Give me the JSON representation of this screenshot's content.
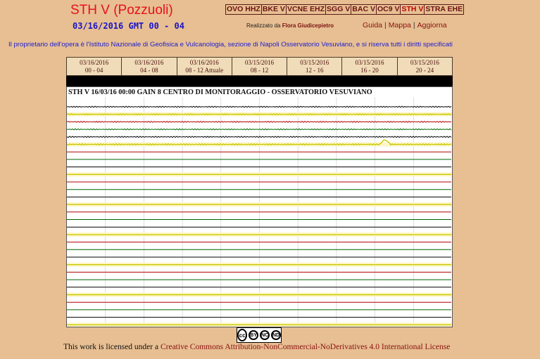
{
  "header": {
    "title": "STH V (Pozzuoli)",
    "subtitle": "03/16/2016 GMT 00 - 04",
    "credit_prefix": "Realizzato da",
    "credit_author": "Flora Giudicepietro"
  },
  "stations": [
    {
      "label": "OVO HHZ"
    },
    {
      "label": "BKE V"
    },
    {
      "label": "VCNE EHZ"
    },
    {
      "label": "SGG V"
    },
    {
      "label": "BAC V"
    },
    {
      "label": "OC9 V"
    },
    {
      "label": "STH V"
    },
    {
      "label": "STRA EHE"
    }
  ],
  "nav": {
    "guida": "Guida",
    "mappa": "Mappa",
    "aggiorna": "Aggiorna",
    "sep": "|"
  },
  "owner_notice": "Il proprietario dell'opera è l'Istituto Nazionale di Geofisica e Vulcanologia, sezione di Napoli Osservatorio Vesuviano, e si riserva tutti i diritti specificati",
  "tabs": [
    {
      "date": "03/16/2016",
      "range": "00 - 04"
    },
    {
      "date": "03/16/2016",
      "range": "04 - 08"
    },
    {
      "date": "03/16/2016",
      "range": "08 - 12 Attuale"
    },
    {
      "date": "03/15/2016",
      "range": "08 - 12"
    },
    {
      "date": "03/15/2016",
      "range": "12 - 16"
    },
    {
      "date": "03/15/2016",
      "range": "16 - 20"
    },
    {
      "date": "03/15/2016",
      "range": "20 - 24"
    }
  ],
  "plot": {
    "header": "STH V 16/03/16 00:00 GAIN  8  CENTRO DI MONITORAGGIO - OSSERVATORIO VESUVIANO",
    "trace_colors": [
      "#000000",
      "#c8c800",
      "#b00000",
      "#006400"
    ]
  },
  "license": {
    "prefix": "This work is licensed under a ",
    "link": "Creative Commons Attribution-NonCommercial-NoDerivatives 4.0 International License",
    "badge_cc": "cc",
    "badge_by": "BY",
    "badge_nc": "NC",
    "badge_nd": "ND"
  }
}
